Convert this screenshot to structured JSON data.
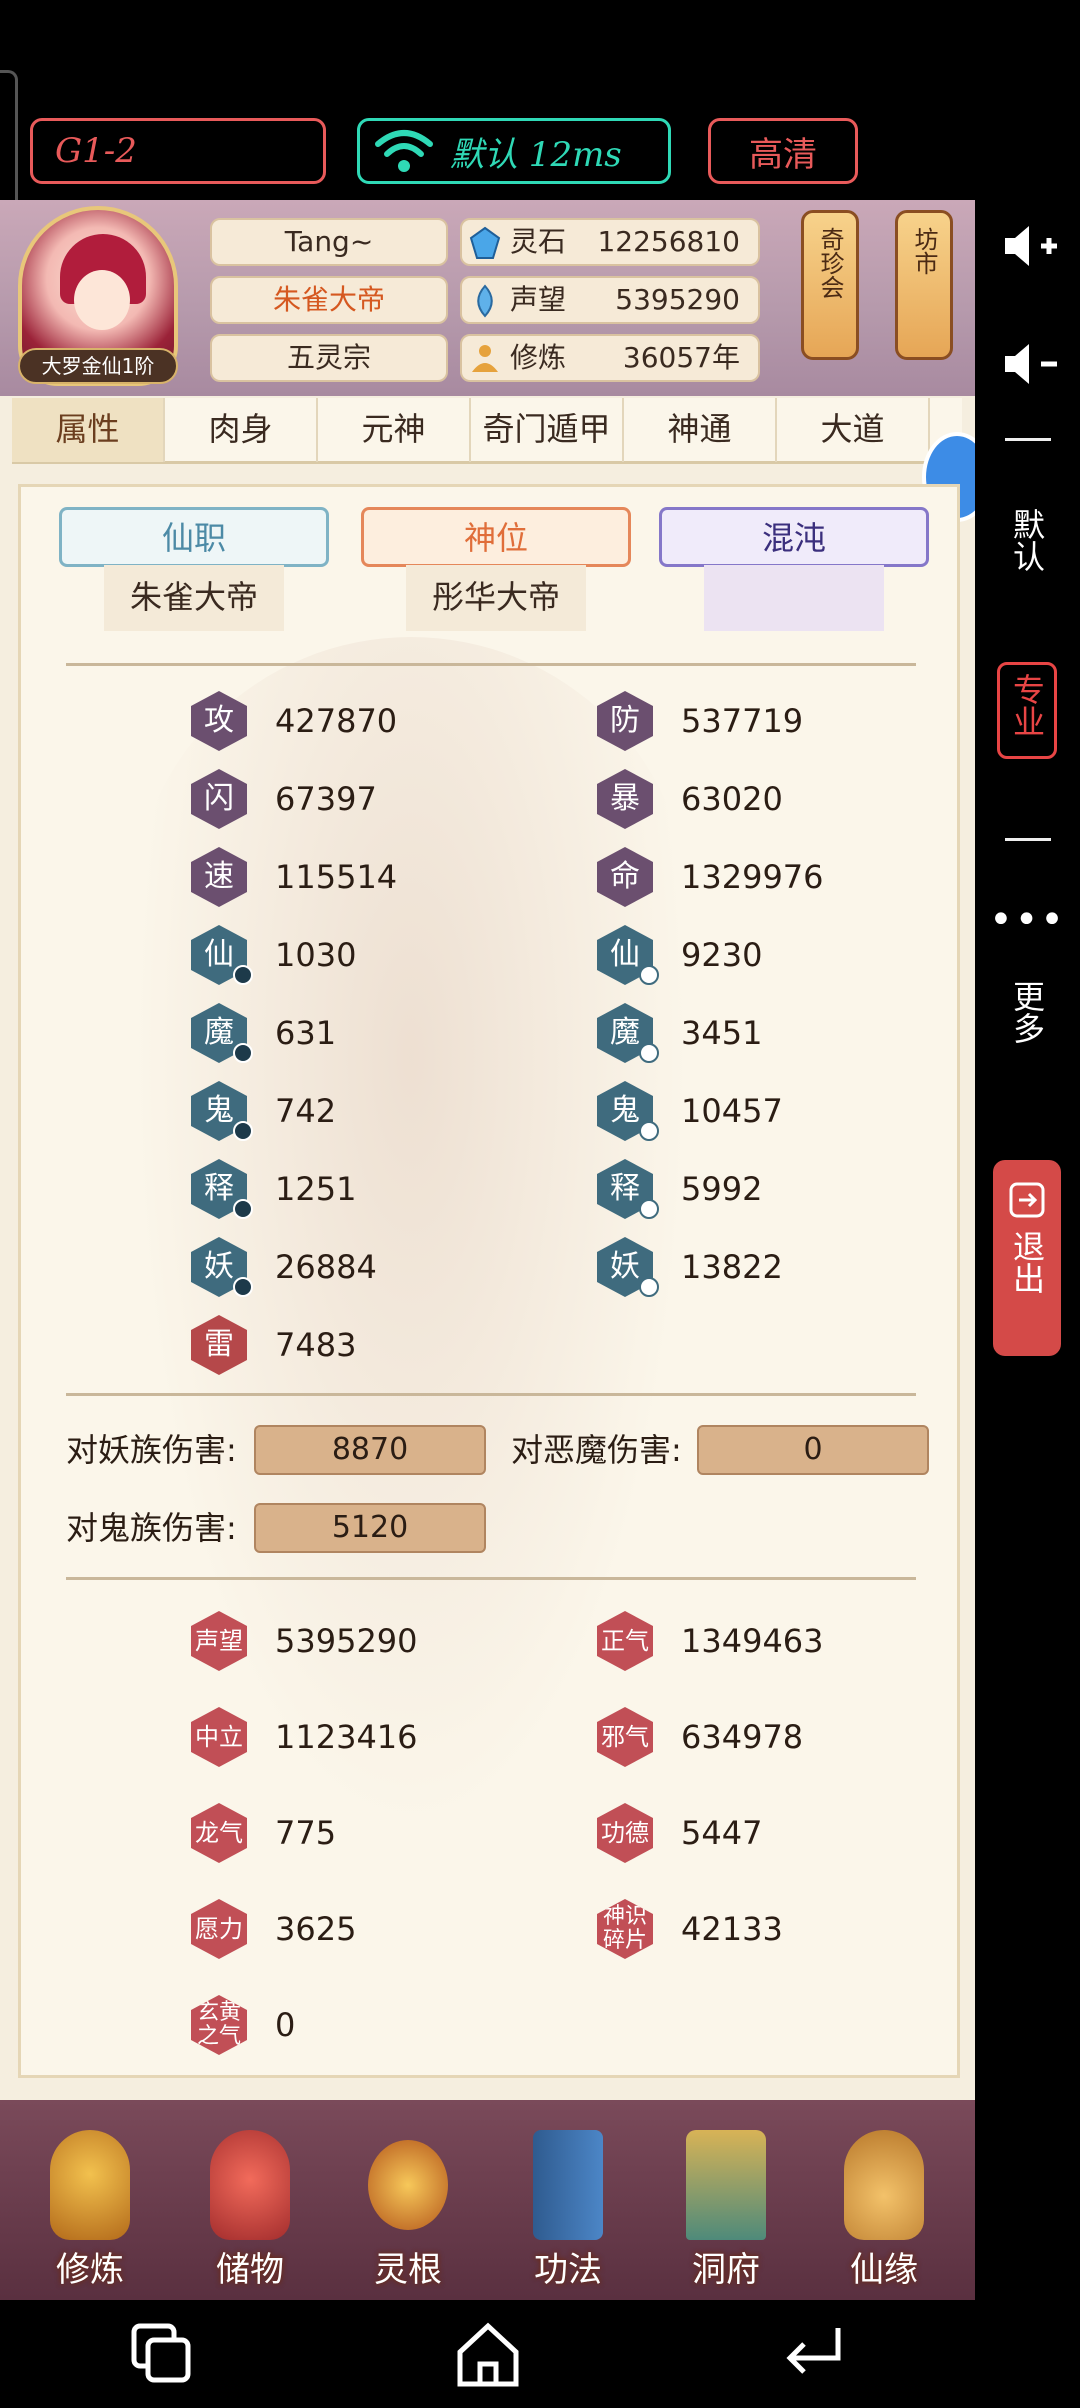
{
  "stream_bar": {
    "server": "G1-2",
    "network": "默认 12ms",
    "quality": "高清"
  },
  "player": {
    "name": "Tang~",
    "title": "朱雀大帝",
    "sect": "五灵宗",
    "rank": "大罗金仙1阶"
  },
  "resources": [
    {
      "icon": "spirit-stone-icon",
      "label": "灵石",
      "value": "12256810"
    },
    {
      "icon": "reputation-icon",
      "label": "声望",
      "value": "5395290"
    },
    {
      "icon": "cultivation-icon",
      "label": "修炼",
      "value": "36057年"
    }
  ],
  "lanterns": {
    "treasure": "奇珍会",
    "market": "坊市"
  },
  "tabs": [
    "属性",
    "肉身",
    "元神",
    "奇门遁甲",
    "神通",
    "大道"
  ],
  "active_tab": "属性",
  "positions": {
    "immortal_post": {
      "label": "仙职",
      "value": "朱雀大帝"
    },
    "divine_post": {
      "label": "神位",
      "value": "彤华大帝"
    },
    "chaos": {
      "label": "混沌",
      "value": ""
    }
  },
  "stats_left": [
    {
      "glyph": "攻",
      "value": "427870"
    },
    {
      "glyph": "闪",
      "value": "67397"
    },
    {
      "glyph": "速",
      "value": "115514"
    },
    {
      "glyph": "仙",
      "value": "1030"
    },
    {
      "glyph": "魔",
      "value": "631"
    },
    {
      "glyph": "鬼",
      "value": "742"
    },
    {
      "glyph": "释",
      "value": "1251"
    },
    {
      "glyph": "妖",
      "value": "26884"
    },
    {
      "glyph": "雷",
      "value": "7483"
    }
  ],
  "stats_right": [
    {
      "glyph": "防",
      "value": "537719"
    },
    {
      "glyph": "暴",
      "value": "63020"
    },
    {
      "glyph": "命",
      "value": "1329976"
    },
    {
      "glyph": "仙",
      "value": "9230"
    },
    {
      "glyph": "魔",
      "value": "3451"
    },
    {
      "glyph": "鬼",
      "value": "10457"
    },
    {
      "glyph": "释",
      "value": "5992"
    },
    {
      "glyph": "妖",
      "value": "13822"
    }
  ],
  "damage": {
    "vs_yao_label": "对妖族伤害:",
    "vs_yao": "8870",
    "vs_demon_label": "对恶魔伤害:",
    "vs_demon": "0",
    "vs_ghost_label": "对鬼族伤害:",
    "vs_ghost": "5120"
  },
  "misc_left": [
    {
      "glyph": "声望",
      "value": "5395290"
    },
    {
      "glyph": "中立",
      "value": "1123416"
    },
    {
      "glyph": "龙气",
      "value": "775"
    },
    {
      "glyph": "愿力",
      "value": "3625"
    },
    {
      "glyph": "玄黄之气",
      "value": "0"
    }
  ],
  "misc_right": [
    {
      "glyph": "正气",
      "value": "1349463"
    },
    {
      "glyph": "邪气",
      "value": "634978"
    },
    {
      "glyph": "功德",
      "value": "5447"
    },
    {
      "glyph": "神识碎片",
      "value": "42133"
    }
  ],
  "bottom_menu": [
    "修炼",
    "储物",
    "灵根",
    "功法",
    "洞府",
    "仙缘"
  ],
  "rail": {
    "default": "默认",
    "pro": "专业",
    "more": "更多",
    "exit": "退出"
  },
  "colors": {
    "accent_red": "#e85a5a",
    "accent_teal": "#2fd9b6",
    "title_orange": "#d55820",
    "damage_box": "#d9b28b"
  }
}
